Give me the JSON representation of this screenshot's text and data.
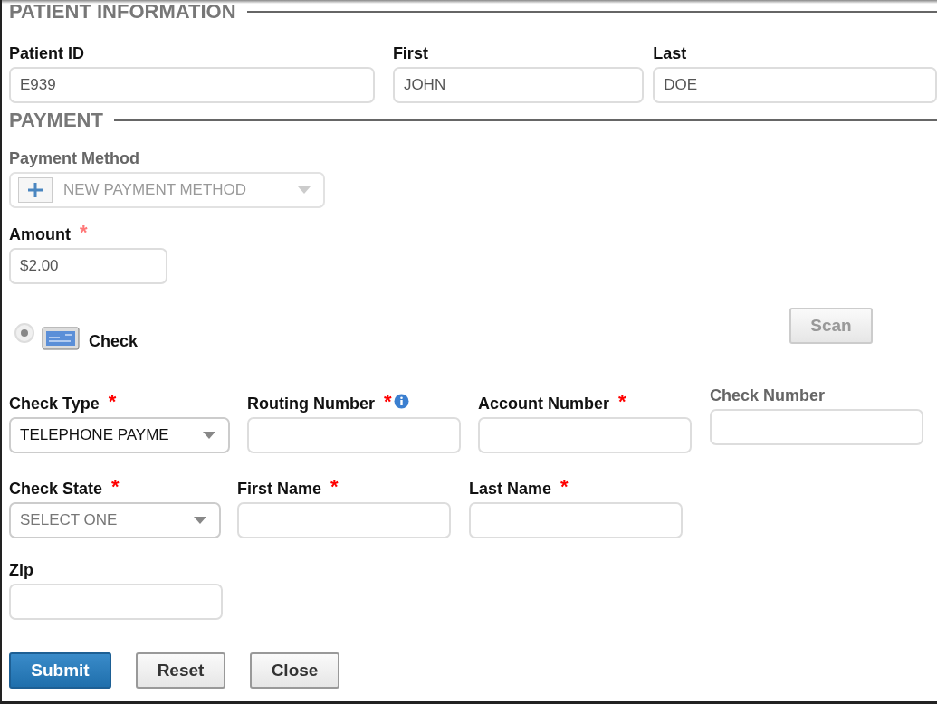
{
  "patient_information": {
    "title": "PATIENT INFORMATION",
    "fields": [
      {
        "label": "Patient ID",
        "kind": "text",
        "value": "E939"
      },
      {
        "label": "First",
        "kind": "text",
        "value": "JOHN"
      },
      {
        "label": "Last",
        "kind": "text",
        "value": "DOE"
      }
    ]
  },
  "payment": {
    "title": "PAYMENT",
    "payment_method": {
      "label": "Payment Method",
      "kind": "add-select",
      "value": "NEW PAYMENT METHOD",
      "disabled": true
    },
    "amount": {
      "label": "Amount",
      "asterisk": "*",
      "kind": "text",
      "value": "$2.00"
    },
    "method_option": {
      "label": "Check",
      "selected": true,
      "disabled": true
    },
    "scan_button": {
      "label": "Scan",
      "disabled": true
    },
    "check_rows": [
      [
        {
          "label": "Check Type",
          "asterisk": "*",
          "kind": "select",
          "value": "TELEPHONE PAYME"
        },
        {
          "label": "Routing Number",
          "asterisk": "*",
          "info_icon": true,
          "kind": "text"
        },
        {
          "label": "Account Number",
          "asterisk": "*",
          "kind": "text"
        },
        {
          "label": "Check Number",
          "kind": "text",
          "disabled": true
        }
      ],
      [
        {
          "label": "Check State",
          "asterisk": "*",
          "kind": "select",
          "value": "SELECT ONE",
          "placeholder_style": true
        },
        {
          "label": "First Name",
          "asterisk": "*",
          "kind": "text"
        },
        {
          "label": "Last Name",
          "asterisk": "*",
          "kind": "text"
        }
      ],
      [
        {
          "label": "Zip",
          "kind": "text"
        }
      ]
    ]
  },
  "buttons": [
    {
      "label": "Submit",
      "primary": true
    },
    {
      "label": "Reset",
      "primary": false
    },
    {
      "label": "Close",
      "primary": false
    }
  ]
}
